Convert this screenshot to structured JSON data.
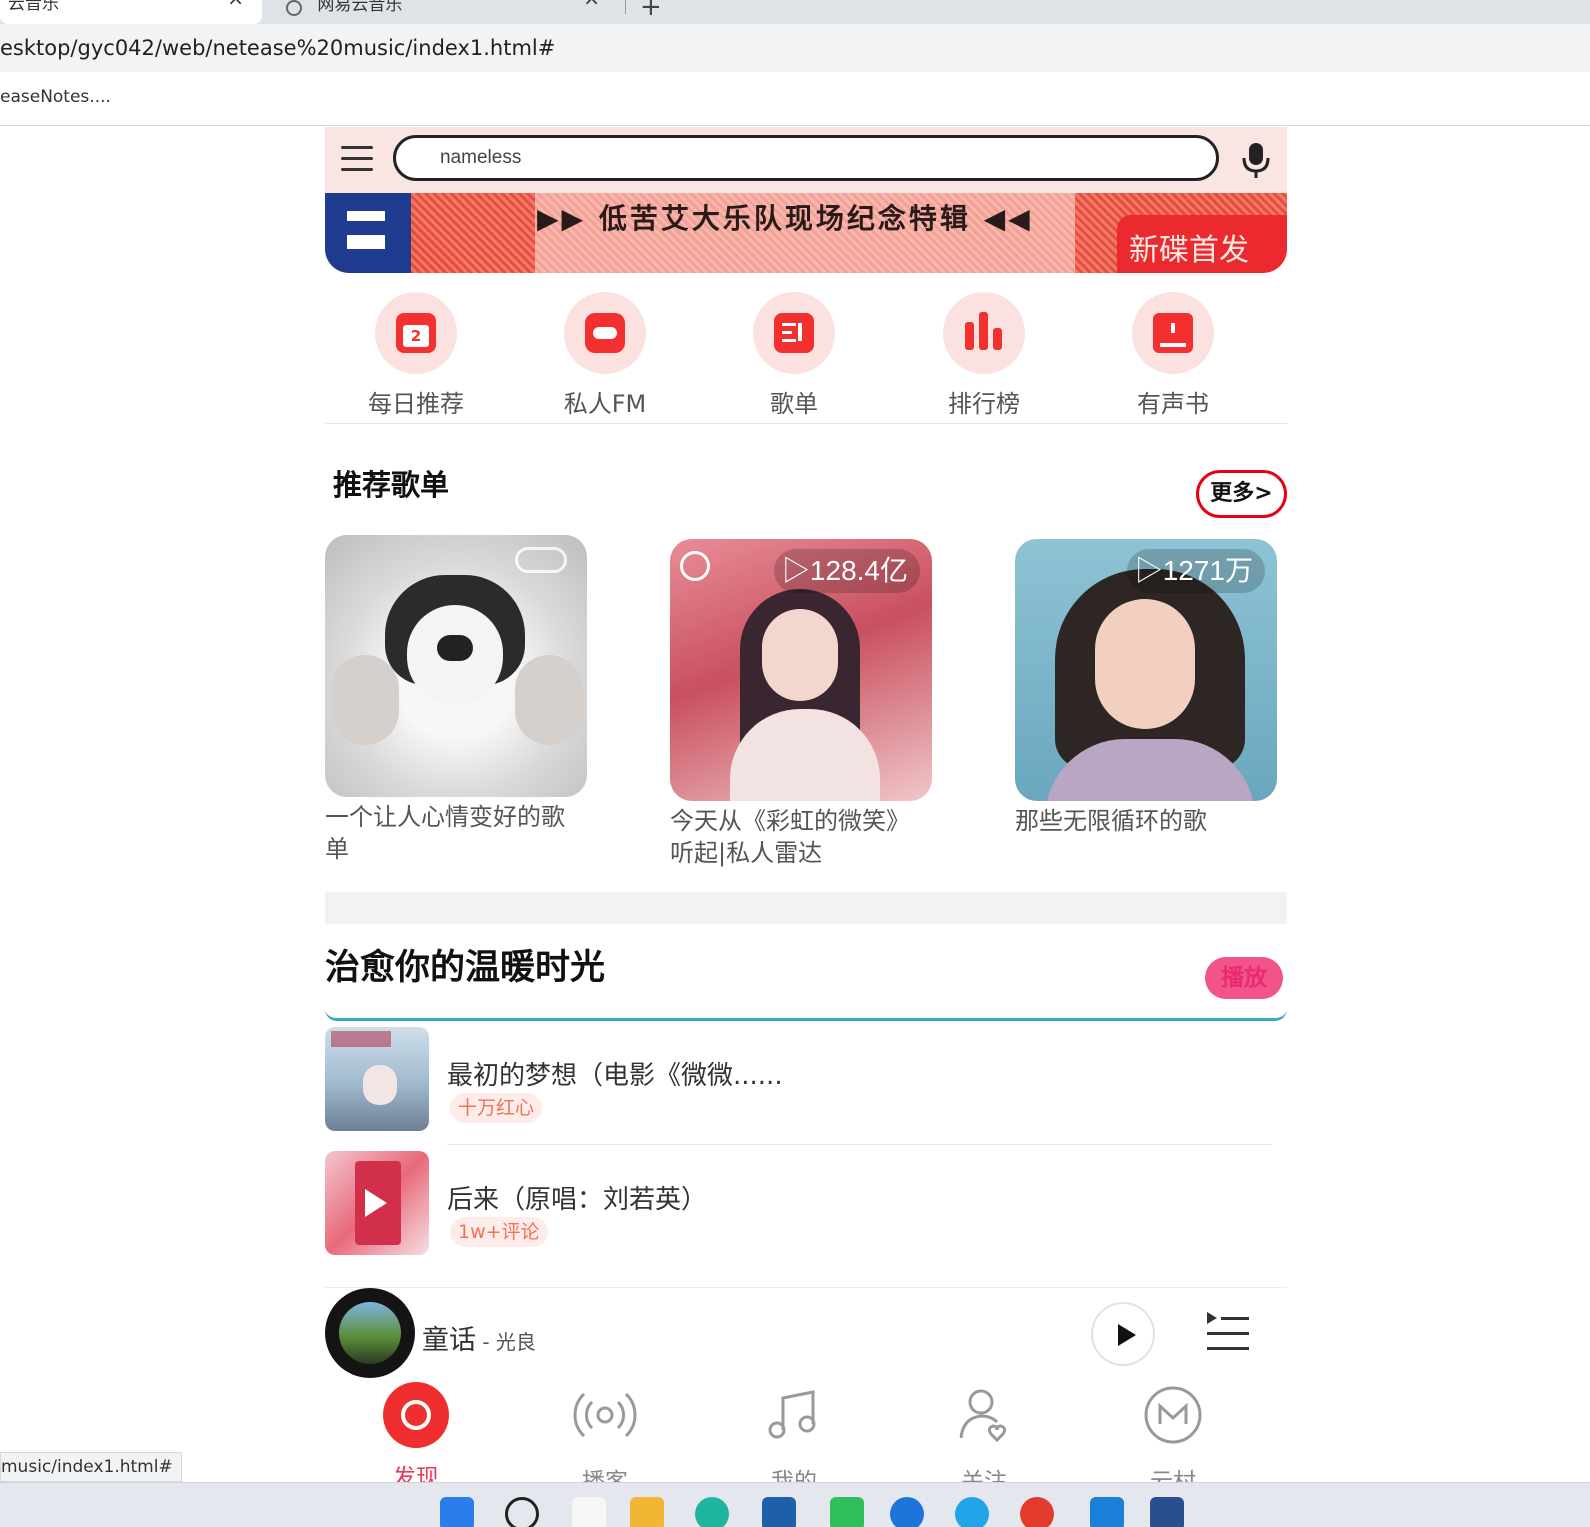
{
  "browser": {
    "tabs": [
      {
        "title": "云音乐",
        "close": "×"
      },
      {
        "title": "网易云音乐",
        "close": "×"
      }
    ],
    "new_tab": "+",
    "url": "esktop/gyc042/web/netease%20music/index1.html#",
    "bookmark": "easeNotes....",
    "status_url": "music/index1.html#"
  },
  "header": {
    "search_value": "nameless",
    "menu_icon": "hamburger-menu-icon",
    "mic_icon": "microphone-icon"
  },
  "banner": {
    "title": "▶▶ 低苦艾大乐队现场纪念特辑 ◀◀",
    "badge": "新碟首发"
  },
  "nav_icons": [
    {
      "label": "每日推荐",
      "icon": "calendar-icon"
    },
    {
      "label": "私人FM",
      "icon": "radio-icon"
    },
    {
      "label": "歌单",
      "icon": "playlist-icon"
    },
    {
      "label": "排行榜",
      "icon": "bar-chart-icon"
    },
    {
      "label": "有声书",
      "icon": "book-icon"
    }
  ],
  "recommend": {
    "title": "推荐歌单",
    "more": "更多>",
    "playlists": [
      {
        "caption": "一个让人心情变好的歌单",
        "count": ""
      },
      {
        "caption": "今天从《彩虹的微笑》听起|私人雷达",
        "count": "128.4亿"
      },
      {
        "caption": "那些无限循环的歌",
        "count": "1271万"
      }
    ]
  },
  "healing": {
    "title": "治愈你的温暖时光",
    "play": "播放",
    "songs": [
      {
        "name": "最初的梦想（电影《微微......",
        "tag": "十万红心"
      },
      {
        "name": "后来（原唱：刘若英）",
        "tag": "1w+评论"
      }
    ]
  },
  "player": {
    "song": "童话",
    "artist": " - 光良"
  },
  "bottom_nav": [
    {
      "label": "发现",
      "icon": "netease-logo-icon",
      "active": true
    },
    {
      "label": "播客",
      "icon": "podcast-icon",
      "active": false
    },
    {
      "label": "我的",
      "icon": "music-note-icon",
      "active": false
    },
    {
      "label": "关注",
      "icon": "follow-user-icon",
      "active": false
    },
    {
      "label": "云村",
      "icon": "cloud-village-icon",
      "active": false
    }
  ],
  "colors": {
    "accent": "#e60012",
    "header_bg": "#f9e5e2",
    "icon_red": "#f2302f",
    "play_pink": "#f2548a",
    "divider_blue": "#3aa7c8"
  }
}
